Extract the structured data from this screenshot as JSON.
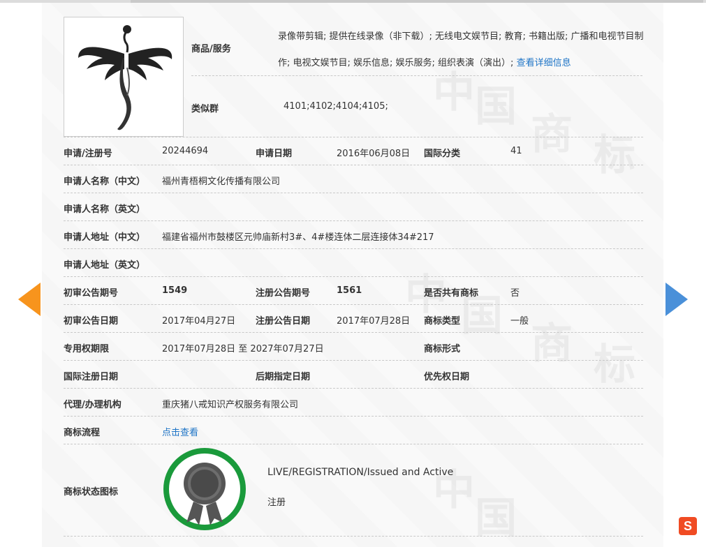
{
  "goods": {
    "label": "商品/服务",
    "text": "录像带剪辑; 提供在线录像（非下载）; 无线电文娱节目; 教育; 书籍出版; 广播和电视节目制作; 电视文娱节目; 娱乐信息; 娱乐服务; 组织表演（演出）; ",
    "detail_link": "查看详细信息"
  },
  "similar_group": {
    "label": "类似群",
    "value": "4101;4102;4104;4105;"
  },
  "row_app": {
    "reg_no_label": "申请/注册号",
    "reg_no": "20244694",
    "app_date_label": "申请日期",
    "app_date": "2016年06月08日",
    "intl_class_label": "国际分类",
    "intl_class": "41"
  },
  "applicant_cn": {
    "label": "申请人名称（中文）",
    "value": "福州青梧桐文化传播有限公司"
  },
  "applicant_en": {
    "label": "申请人名称（英文）",
    "value": ""
  },
  "address_cn": {
    "label": "申请人地址（中文）",
    "value": "福建省福州市鼓楼区元帅庙新村3#、4#楼连体二层连接体34#217"
  },
  "address_en": {
    "label": "申请人地址（英文）",
    "value": ""
  },
  "row_pub": {
    "prelim_no_label": "初审公告期号",
    "prelim_no": "1549",
    "reg_pub_no_label": "注册公告期号",
    "reg_pub_no": "1561",
    "shared_label": "是否共有商标",
    "shared": "否"
  },
  "row_pub_date": {
    "prelim_date_label": "初审公告日期",
    "prelim_date": "2017年04月27日",
    "reg_pub_date_label": "注册公告日期",
    "reg_pub_date": "2017年07月28日",
    "type_label": "商标类型",
    "type": "一般"
  },
  "row_term": {
    "term_label": "专用权期限",
    "term": "2017年07月28日 至 2027年07月27日",
    "form_label": "商标形式",
    "form": ""
  },
  "row_intl": {
    "intl_reg_label": "国际注册日期",
    "intl_reg": "",
    "later_label": "后期指定日期",
    "later": "",
    "priority_label": "优先权日期",
    "priority": ""
  },
  "agent": {
    "label": "代理/办理机构",
    "value": "重庆猪八戒知识产权服务有限公司"
  },
  "process": {
    "label": "商标流程",
    "link": "点击查看"
  },
  "status": {
    "label": "商标状态图标",
    "en": "LIVE/REGISTRATION/Issued and Active",
    "cn": "注册"
  },
  "watermark": [
    "中",
    "国",
    "商",
    "标"
  ],
  "icons": {
    "prev": "arrow-left-icon",
    "next": "arrow-right-icon",
    "logo": "trademark-logo-image",
    "seal": "registered-seal-icon",
    "sogou": "sogou-s-icon"
  },
  "sogou_letter": "S",
  "colors": {
    "link": "#1e74c6",
    "prev_arrow": "#f7941d",
    "next_arrow": "#4a90d9",
    "seal_ring": "#1a9a3b"
  }
}
